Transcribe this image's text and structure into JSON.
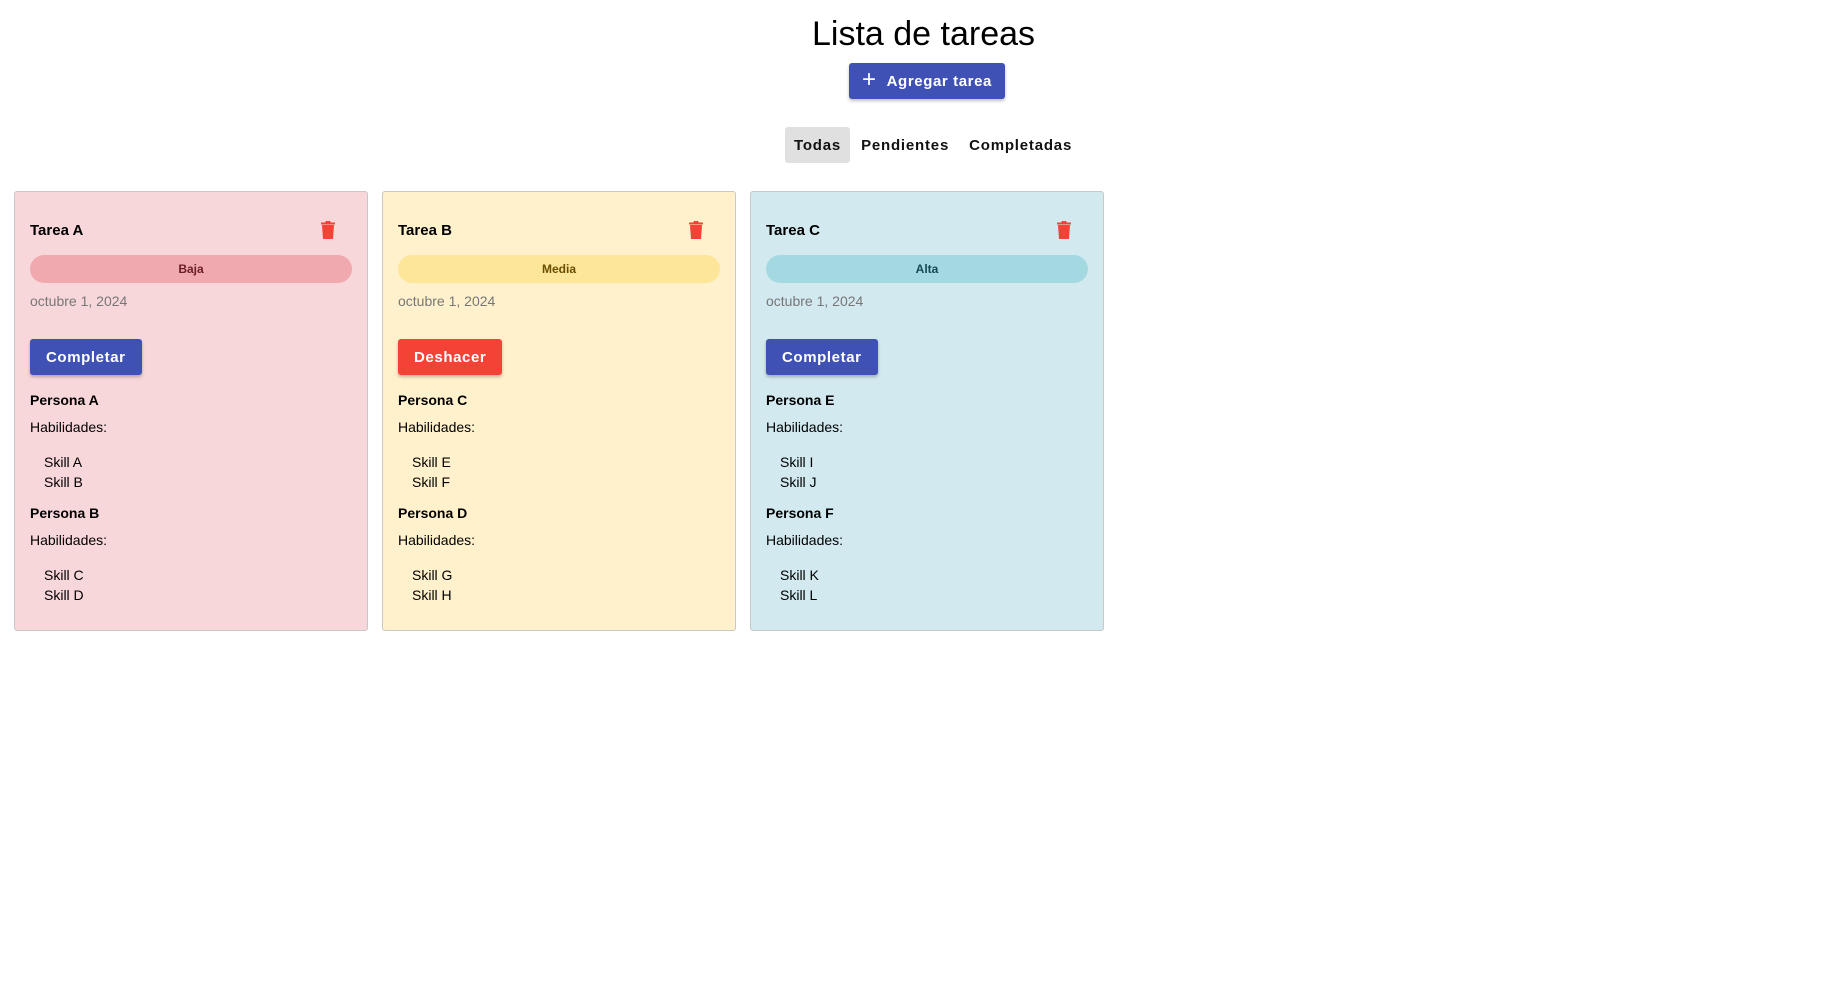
{
  "page": {
    "title": "Lista de tareas",
    "add_button": {
      "icon": "plus-icon",
      "label": "Agregar tarea"
    }
  },
  "filters": [
    {
      "label": "Todas",
      "active": true
    },
    {
      "label": "Pendientes",
      "active": false
    },
    {
      "label": "Completadas",
      "active": false
    }
  ],
  "colors": {
    "primary": "#3f51b5",
    "danger": "#f44336",
    "card_low": "#f8d7da",
    "card_medium": "#fff1cc",
    "card_high": "#d1e9ef"
  },
  "tasks": [
    {
      "title": "Tarea A",
      "priority": "Baja",
      "date": "octubre 1, 2024",
      "action_label": "Completar",
      "people": [
        {
          "name": "Persona A",
          "skills_label": "Habilidades:",
          "skills": [
            "Skill A",
            "Skill B"
          ]
        },
        {
          "name": "Persona B",
          "skills_label": "Habilidades:",
          "skills": [
            "Skill C",
            "Skill D"
          ]
        }
      ]
    },
    {
      "title": "Tarea B",
      "priority": "Media",
      "date": "octubre 1, 2024",
      "action_label": "Deshacer",
      "people": [
        {
          "name": "Persona C",
          "skills_label": "Habilidades:",
          "skills": [
            "Skill E",
            "Skill F"
          ]
        },
        {
          "name": "Persona D",
          "skills_label": "Habilidades:",
          "skills": [
            "Skill G",
            "Skill H"
          ]
        }
      ]
    },
    {
      "title": "Tarea C",
      "priority": "Alta",
      "date": "octubre 1, 2024",
      "action_label": "Completar",
      "people": [
        {
          "name": "Persona E",
          "skills_label": "Habilidades:",
          "skills": [
            "Skill I",
            "Skill J"
          ]
        },
        {
          "name": "Persona F",
          "skills_label": "Habilidades:",
          "skills": [
            "Skill K",
            "Skill L"
          ]
        }
      ]
    }
  ]
}
